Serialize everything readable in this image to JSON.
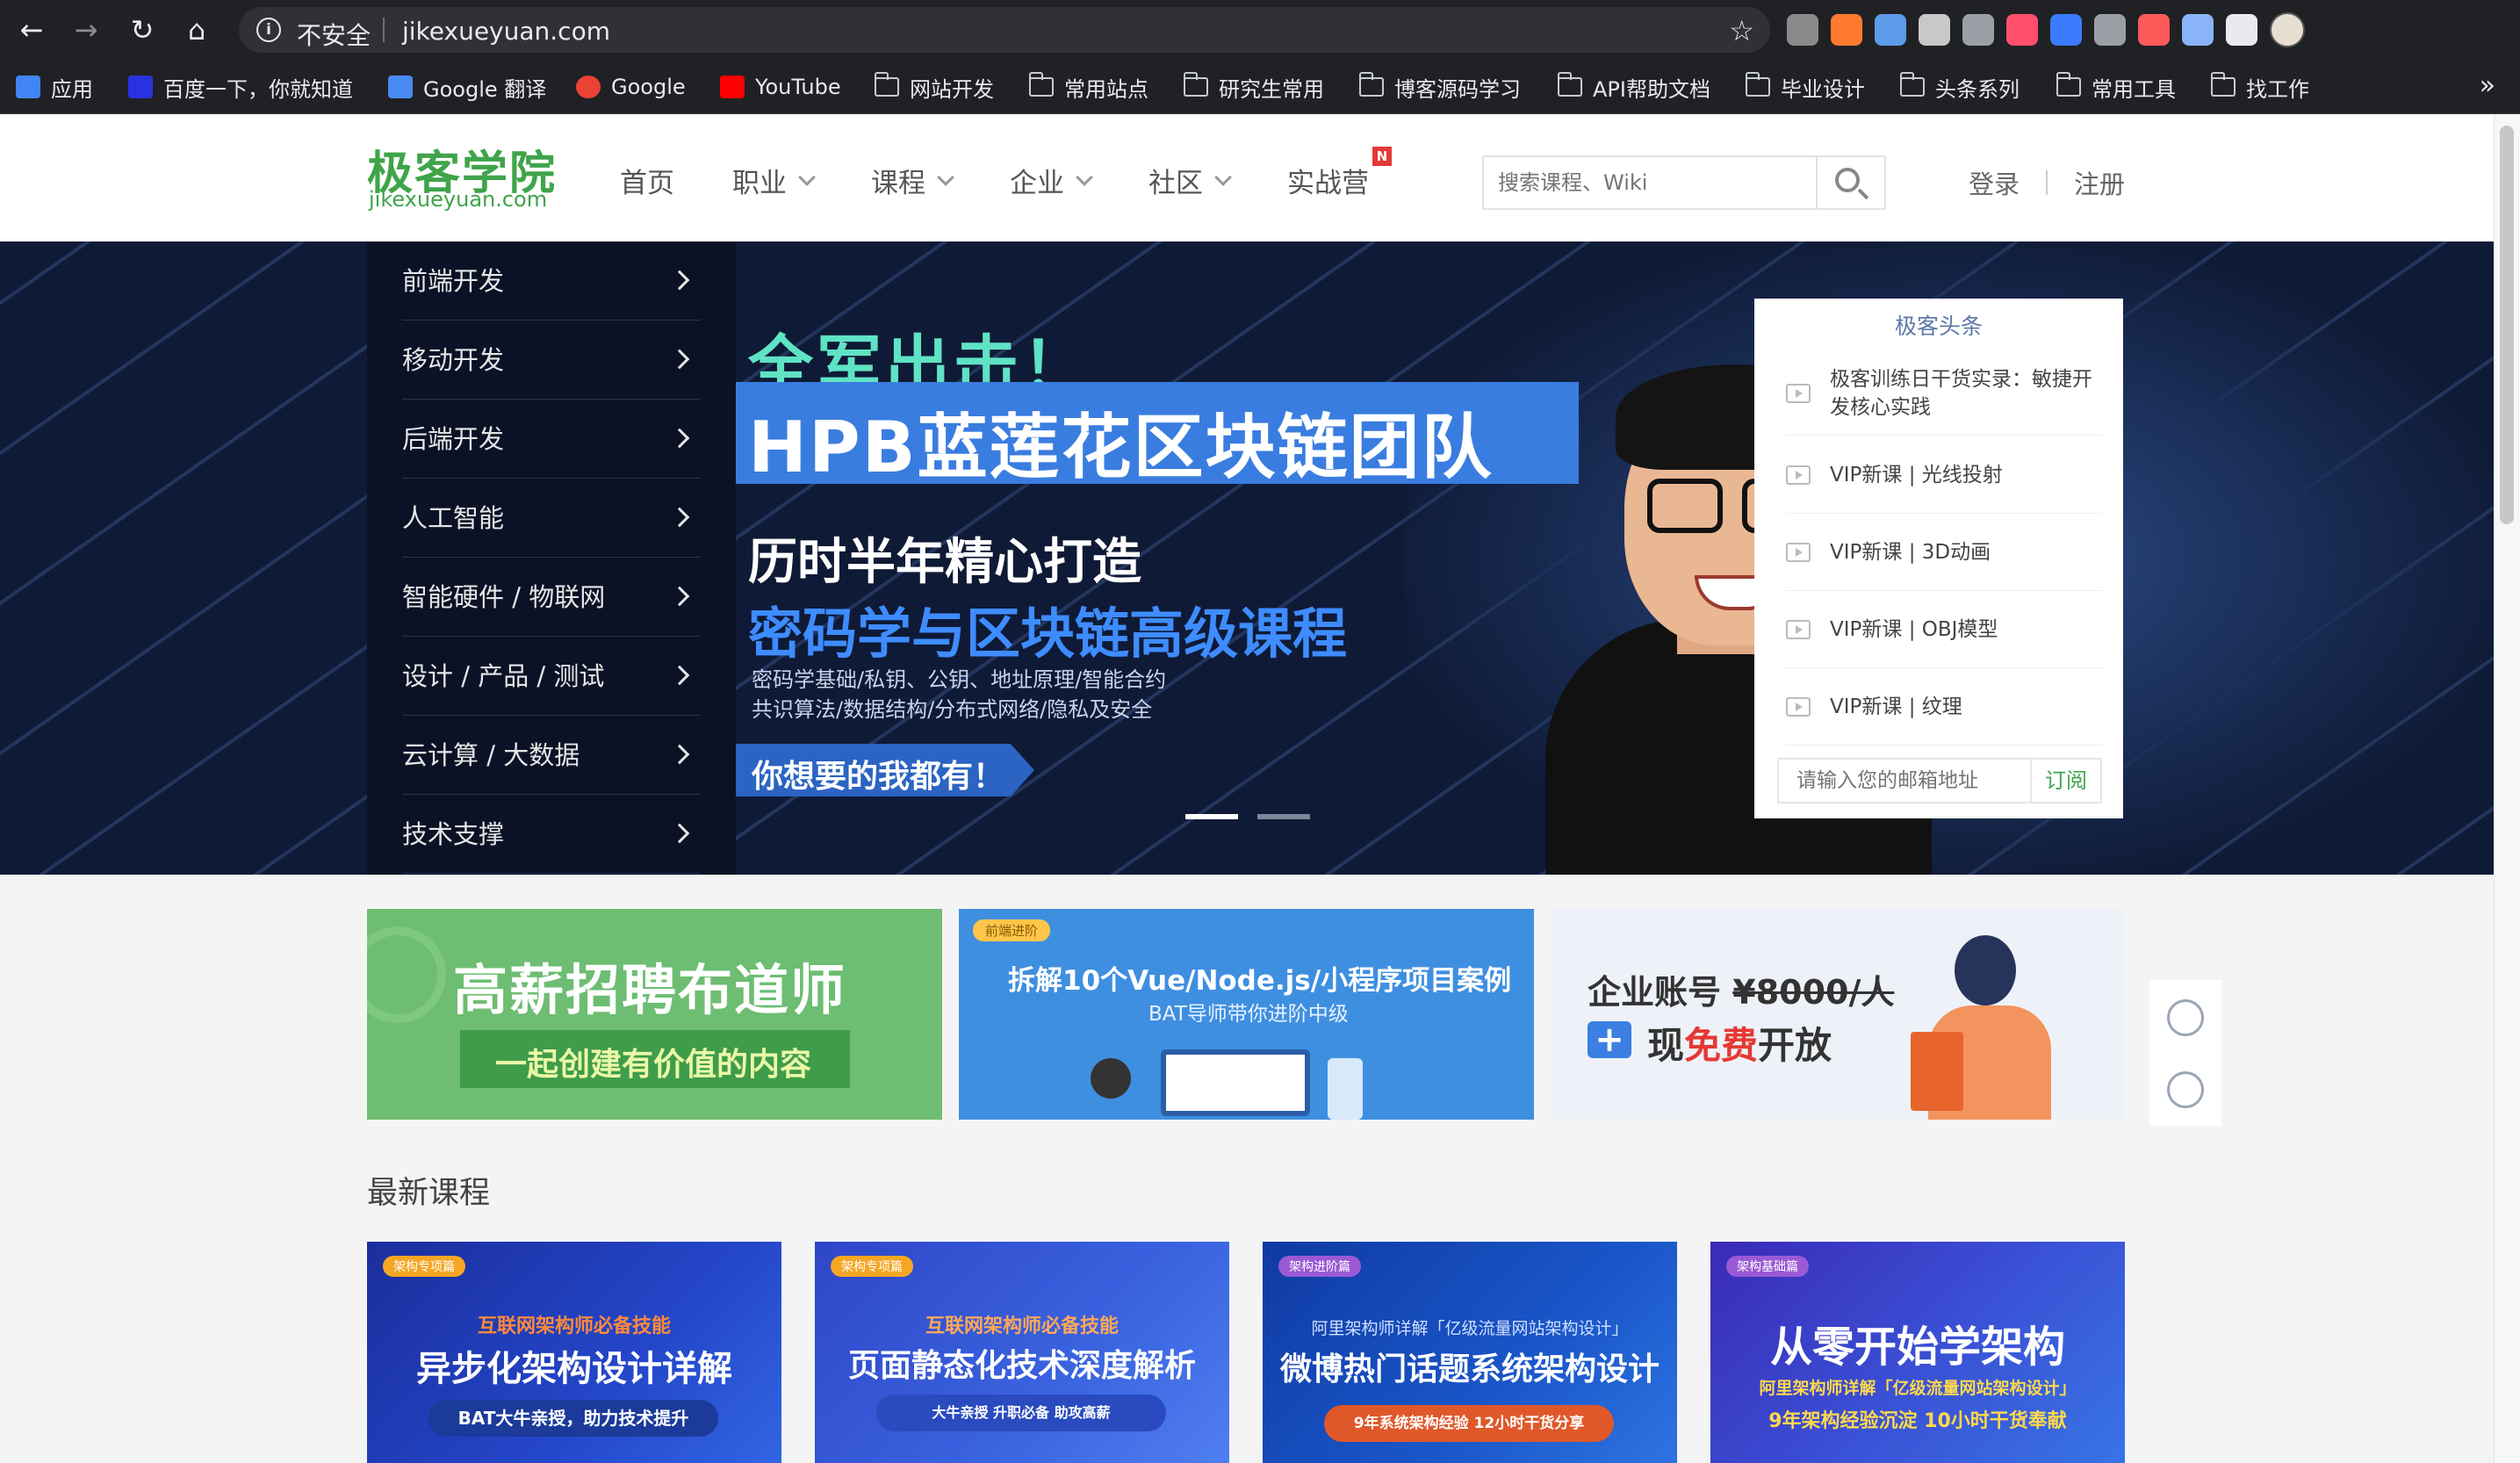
{
  "browser": {
    "security_label": "不安全",
    "url": "jikexueyuan.com",
    "extension_colors": [
      "#8a8a8a",
      "#ff7a2e",
      "#5b9be8",
      "#c8c8c8",
      "#9aa0a6",
      "#ff4f6d",
      "#3b7cff",
      "#9aa0a6",
      "#ff5a5a",
      "#8ab4f8",
      "#e8eaed"
    ]
  },
  "bookmarks": [
    {
      "label": "应用",
      "icon": "apps-grid-icon"
    },
    {
      "label": "百度一下，你就知道",
      "icon": "baidu-icon"
    },
    {
      "label": "Google 翻译",
      "icon": "google-translate-icon"
    },
    {
      "label": "Google",
      "icon": "google-icon"
    },
    {
      "label": "YouTube",
      "icon": "youtube-icon"
    },
    {
      "label": "网站开发",
      "icon": "folder-icon"
    },
    {
      "label": "常用站点",
      "icon": "folder-icon"
    },
    {
      "label": "研究生常用",
      "icon": "folder-icon"
    },
    {
      "label": "博客源码学习",
      "icon": "folder-icon"
    },
    {
      "label": "API帮助文档",
      "icon": "folder-icon"
    },
    {
      "label": "毕业设计",
      "icon": "folder-icon"
    },
    {
      "label": "头条系列",
      "icon": "folder-icon"
    },
    {
      "label": "常用工具",
      "icon": "folder-icon"
    },
    {
      "label": "找工作",
      "icon": "folder-icon"
    }
  ],
  "bookmarks_more": "»",
  "site": {
    "logo_cn": "极客学院",
    "logo_en": "jikexueyuan.com",
    "nav": [
      "首页",
      "职业",
      "课程",
      "企业",
      "社区",
      "实战营"
    ],
    "nav_new_badge": "N",
    "search_placeholder": "搜索课程、Wiki",
    "login": "登录",
    "register": "注册"
  },
  "side_menu": [
    "前端开发",
    "移动开发",
    "后端开发",
    "人工智能",
    "智能硬件 / 物联网",
    "设计 / 产品 / 测试",
    "云计算 / 大数据",
    "技术支撑"
  ],
  "hero": {
    "line1": "全军出击！",
    "line2": "HPB蓝莲花区块链团队",
    "line3": "历时半年精心打造",
    "line4": "密码学与区块链高级课程",
    "line5a": "密码学基础/私钥、公钥、地址原理/智能合约",
    "line5b": "共识算法/数据结构/分布式网络/隐私及安全",
    "cta": "你想要的我都有！",
    "active_slide": 1,
    "slide_count": 2
  },
  "news": {
    "title": "极客头条",
    "items": [
      "极客训练日干货实录：敏捷开发核心实践",
      "VIP新课 | 光线投射",
      "VIP新课 | 3D动画",
      "VIP新课 | OBJ模型",
      "VIP新课 | 纹理"
    ],
    "email_placeholder": "请输入您的邮箱地址",
    "subscribe": "订阅"
  },
  "promos": {
    "p1_big": "高薪招聘布道师",
    "p1_small": "一起创建有价值的内容",
    "p2_tag": "前端进阶",
    "p2_big": "拆解10个Vue/Node.js/小程序项目案例",
    "p2_small": "BAT导师带你进阶中级",
    "p3_prefix": "企业账号",
    "p3_price": "¥8000/人",
    "p3_free_a": "现",
    "p3_free_red": "免费",
    "p3_free_b": "开放"
  },
  "section_title": "最新课程",
  "courses": [
    {
      "tag": "架构专项篇",
      "top": "互联网架构师必备技能",
      "title": "异步化架构设计详解",
      "pill": "BAT大牛亲授，助力技术提升"
    },
    {
      "tag": "架构专项篇",
      "top": "互联网架构师必备技能",
      "title": "页面静态化技术深度解析",
      "pill": "大牛亲授  升职必备  助攻高薪"
    },
    {
      "tag": "架构进阶篇",
      "top": "阿里架构师详解「亿级流量网站架构设计」",
      "title": "微博热门话题系统架构设计",
      "pill": "9年系统架构经验  12小时干货分享"
    },
    {
      "tag": "架构基础篇",
      "top": "阿里架构师详解「亿级流量网站架构设计」",
      "title": "从零开始学架构",
      "pill": "9年架构经验沉淀  10小时干货奉献"
    }
  ]
}
